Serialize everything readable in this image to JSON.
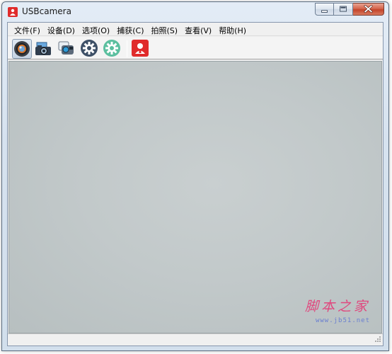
{
  "window": {
    "title": "USBcamera"
  },
  "menu": {
    "items": [
      {
        "label": "文件(F)",
        "name": "menu-file"
      },
      {
        "label": "设备(D)",
        "name": "menu-device"
      },
      {
        "label": "选项(O)",
        "name": "menu-options"
      },
      {
        "label": "捕获(C)",
        "name": "menu-capture"
      },
      {
        "label": "拍照(S)",
        "name": "menu-photo"
      },
      {
        "label": "查看(V)",
        "name": "menu-view"
      },
      {
        "label": "帮助(H)",
        "name": "menu-help"
      }
    ]
  },
  "toolbar": {
    "buttons": [
      {
        "icon": "camera-lens-icon",
        "active": true
      },
      {
        "icon": "photo-camera-icon",
        "active": false
      },
      {
        "icon": "video-camera-icon",
        "active": false
      },
      {
        "icon": "settings-gear-icon",
        "active": false
      },
      {
        "icon": "settings-gear-green-icon",
        "active": false
      },
      {
        "icon": "user-profile-icon",
        "active": false
      }
    ]
  },
  "watermark": {
    "text": "脚本之家",
    "url": "www.jb51.net"
  },
  "colors": {
    "preview_bg": "#c4cacb",
    "accent_red": "#e02b2b",
    "gear_dark": "#3d4f66",
    "gear_green": "#5bbf9f",
    "watermark_pink": "#e0487e",
    "watermark_blue": "#6a7fd0"
  }
}
